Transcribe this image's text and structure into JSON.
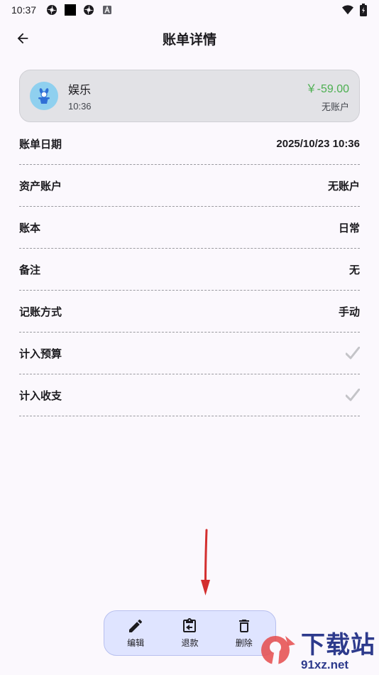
{
  "status_bar": {
    "time": "10:37",
    "icons": [
      "settings-icon",
      "black-square-icon",
      "settings-icon",
      "a-icon"
    ],
    "right_icons": [
      "wifi-icon",
      "battery-icon"
    ]
  },
  "header": {
    "title": "账单详情",
    "back_icon": "arrow-left-icon"
  },
  "summary": {
    "category": "娱乐",
    "time": "10:36",
    "amount": "￥-59.00",
    "account": "无账户",
    "amount_color": "#4caf50",
    "avatar_color": "#8fd0ef",
    "icon": "magic-hat-icon"
  },
  "details": [
    {
      "label": "账单日期",
      "value": "2025/10/23 10:36"
    },
    {
      "label": "资产账户",
      "value": "无账户"
    },
    {
      "label": "账本",
      "value": "日常"
    },
    {
      "label": "备注",
      "value": "无"
    },
    {
      "label": "记账方式",
      "value": "手动"
    },
    {
      "label": "计入预算",
      "checked": true
    },
    {
      "label": "计入收支",
      "checked": true
    }
  ],
  "actions": {
    "edit": "编辑",
    "refund": "退款",
    "delete": "删除"
  },
  "watermark": {
    "title": "下载站",
    "url": "91xz.net"
  },
  "colors": {
    "background": "#fbf8fd",
    "action_bar": "#dfe4ff",
    "arrow": "#d32f2f"
  }
}
